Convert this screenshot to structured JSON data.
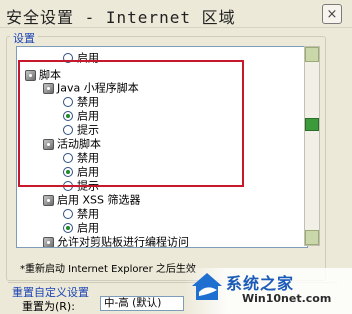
{
  "window": {
    "title": "安全设置 - Internet 区域"
  },
  "group": {
    "label": "设置"
  },
  "tree": [
    {
      "type": "radio",
      "label": "启用",
      "checked": false
    },
    {
      "type": "header",
      "label": "脚本"
    },
    {
      "type": "header",
      "label": "Java 小程序脚本"
    },
    {
      "type": "radio",
      "label": "禁用",
      "checked": false
    },
    {
      "type": "radio",
      "label": "启用",
      "checked": true
    },
    {
      "type": "radio",
      "label": "提示",
      "checked": false
    },
    {
      "type": "header",
      "label": "活动脚本"
    },
    {
      "type": "radio",
      "label": "禁用",
      "checked": false
    },
    {
      "type": "radio",
      "label": "启用",
      "checked": true
    },
    {
      "type": "radio",
      "label": "提示",
      "checked": false
    },
    {
      "type": "header",
      "label": "启用 XSS 筛选器"
    },
    {
      "type": "radio",
      "label": "禁用",
      "checked": false
    },
    {
      "type": "radio",
      "label": "启用",
      "checked": true
    },
    {
      "type": "header",
      "label": "允许对剪贴板进行编程访问"
    }
  ],
  "note": "*重新启动 Internet Explorer 之后生效",
  "reset": {
    "section_label": "重置自定义设置",
    "to_label": "重置为(R):",
    "level_value": "中-高 (默认)"
  },
  "watermark": {
    "brand": "系统之家",
    "url": "Win10net.com"
  },
  "colors": {
    "highlight_box": "#c8182b",
    "scroll_thumb": "#3c9a3a",
    "accent_text": "#1a44b6"
  }
}
